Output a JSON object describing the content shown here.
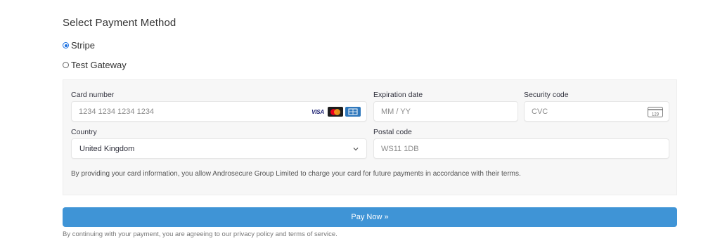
{
  "header": {
    "title": "Select Payment Method"
  },
  "payment_methods": [
    {
      "label": "Stripe",
      "selected": true
    },
    {
      "label": "Test Gateway",
      "selected": false
    }
  ],
  "card_form": {
    "card_number": {
      "label": "Card number",
      "placeholder": "1234 1234 1234 1234",
      "brands": [
        "VISA",
        "mastercard",
        "amex"
      ]
    },
    "expiration": {
      "label": "Expiration date",
      "placeholder": "MM / YY"
    },
    "security": {
      "label": "Security code",
      "placeholder": "CVC",
      "icon": "card-cvc-icon",
      "icon_text": "123"
    },
    "country": {
      "label": "Country",
      "value": "United Kingdom"
    },
    "postal": {
      "label": "Postal code",
      "placeholder": "WS11 1DB"
    },
    "notice": "By providing your card information, you allow Androsecure Group Limited to charge your card for future payments in accordance with their terms."
  },
  "pay_button": {
    "label": "Pay Now »"
  },
  "footer": {
    "text": "By continuing with your payment, you are agreeing to our privacy policy and terms of service."
  },
  "colors": {
    "accent": "#3f94d6",
    "radio_selected": "#1a6fe0",
    "panel_bg": "#f7f7f7"
  }
}
